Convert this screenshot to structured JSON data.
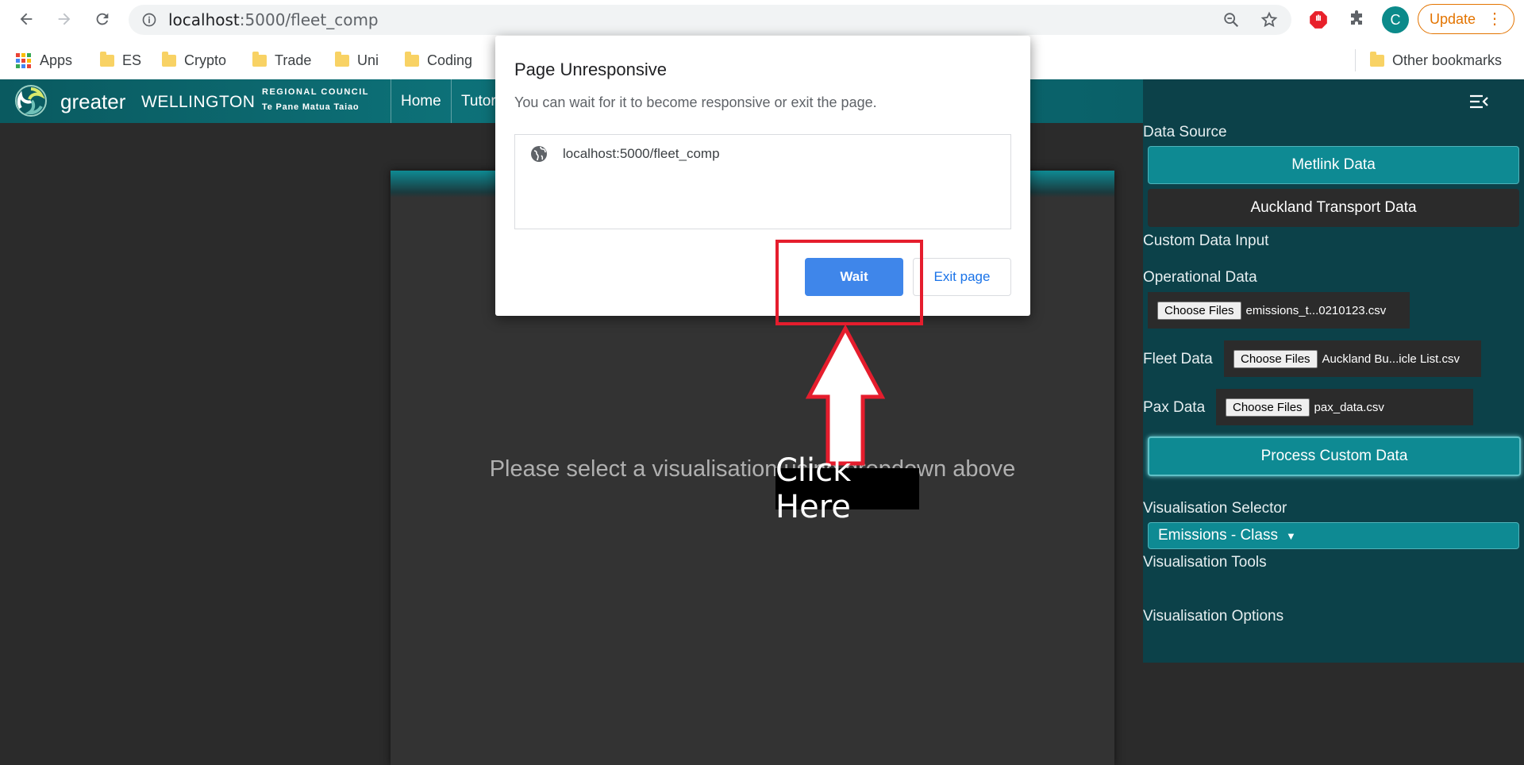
{
  "browser": {
    "url_host": "localhost",
    "url_path": ":5000/fleet_comp",
    "update_label": "Update",
    "avatar_initial": "C",
    "bookmarks": [
      "Apps",
      "ES",
      "Crypto",
      "Trade",
      "Uni",
      "Coding"
    ],
    "other_bookmarks": "Other bookmarks"
  },
  "header": {
    "logo_greater": "greater",
    "logo_wellington": "WELLINGTON",
    "logo_regional": "REGIONAL COUNCIL",
    "logo_tepane": "Te Pane Matua Taiao",
    "nav": [
      "Home",
      "Tutor"
    ]
  },
  "main": {
    "placeholder": "Please select a visualisation using dropdown above"
  },
  "sidebar": {
    "data_source_label": "Data Source",
    "metlink_btn": "Metlink Data",
    "auckland_btn": "Auckland Transport Data",
    "custom_input_label": "Custom Data Input",
    "operational_label": "Operational Data",
    "choose_files": "Choose Files",
    "operational_file": "emissions_t...0210123.csv",
    "fleet_label": "Fleet Data",
    "fleet_file": "Auckland Bu...icle List.csv",
    "pax_label": "Pax Data",
    "pax_file": "pax_data.csv",
    "process_btn": "Process Custom Data",
    "vis_selector_label": "Visualisation Selector",
    "vis_selected": "Emissions - Class",
    "vis_tools_label": "Visualisation Tools",
    "vis_options_label": "Visualisation Options"
  },
  "dialog": {
    "title": "Page Unresponsive",
    "message": "You can wait for it to become responsive or exit the page.",
    "url": "localhost:5000/fleet_comp",
    "wait_label": "Wait",
    "exit_label": "Exit page"
  },
  "annotation": {
    "click_here": "Click Here"
  },
  "colors": {
    "teal_accent": "#0e8a93",
    "sidebar_bg": "#0c4149",
    "annotation_red": "#e51d2d",
    "wait_blue": "#3f86ea"
  }
}
